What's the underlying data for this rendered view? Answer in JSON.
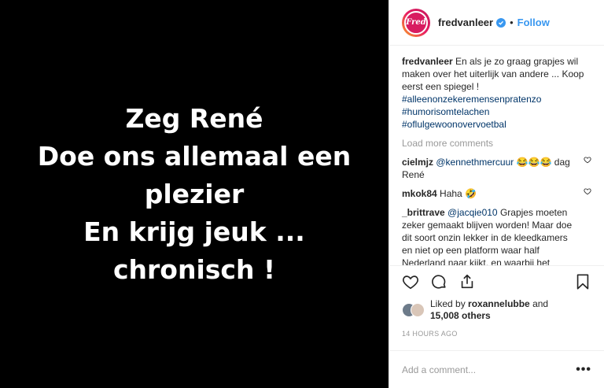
{
  "media": {
    "lines": [
      "Zeg René",
      "Doe ons allemaal een",
      "plezier",
      "En krijg jeuk ...",
      "chronisch !"
    ]
  },
  "header": {
    "avatar_text": "Fred",
    "username": "fredvanleer",
    "dot": "•",
    "follow_label": "Follow"
  },
  "caption": {
    "author": "fredvanleer",
    "text": "En als je zo graag grapjes wil maken over het uiterlijk van andere ... Koop eerst een spiegel !",
    "hashtags": [
      "#alleenonzekeremensenpratenzo",
      "#humorisomtelachen",
      "#oflulgewoonovervoetbal"
    ]
  },
  "load_more": "Load more comments",
  "comments": [
    {
      "author": "cielmjz",
      "mention": "@kennethmercuur",
      "text": " 😂😂😂 dag René"
    },
    {
      "author": "mkok84",
      "mention": "",
      "text": "Haha 🤣"
    },
    {
      "author": "_brittrave",
      "mention": "@jacqie010",
      "text": " Grapjes moeten zeker gemaakt blijven worden! Maar doe dit soort onzin lekker in de kleedkamers en niet op een platform waar half Nederland naar kijkt, en waarbij het hoofdonderwerp voetbal is en volgens mij niet de lengte van de vriendin van Guus Meeuwis...?!"
    }
  ],
  "likes": {
    "prefix": "Liked by",
    "user": "roxannelubbe",
    "and": "and",
    "others": "15,008 others"
  },
  "timestamp": "14 HOURS AGO",
  "add_comment": {
    "placeholder": "Add a comment...",
    "more_label": "•••"
  },
  "colors": {
    "accent": "#3897f0",
    "link": "#003569",
    "muted": "#999999"
  }
}
